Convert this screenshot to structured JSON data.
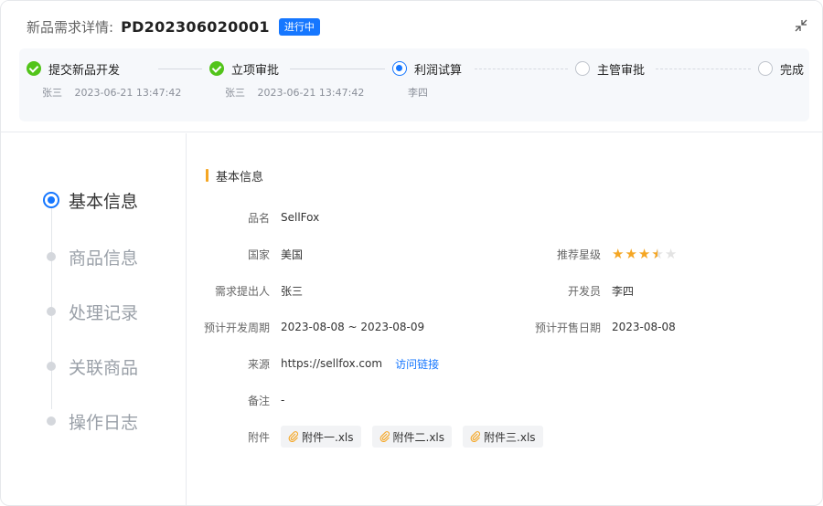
{
  "header": {
    "title_label": "新品需求详情:",
    "code": "PD202306020001",
    "status": "进行中"
  },
  "colors": {
    "primary": "#1677ff",
    "success": "#52c41a",
    "accent": "#f5a623"
  },
  "steps": [
    {
      "title": "提交新品开发",
      "person": "张三",
      "time": "2023-06-21 13:47:42",
      "state": "done"
    },
    {
      "title": "立项审批",
      "person": "张三",
      "time": "2023-06-21 13:47:42",
      "state": "done"
    },
    {
      "title": "利润试算",
      "person": "李四",
      "time": "",
      "state": "active"
    },
    {
      "title": "主管审批",
      "person": "",
      "time": "",
      "state": "wait"
    },
    {
      "title": "完成",
      "person": "",
      "time": "",
      "state": "wait"
    }
  ],
  "nav": {
    "items": [
      {
        "label": "基本信息",
        "active": true
      },
      {
        "label": "商品信息",
        "active": false
      },
      {
        "label": "处理记录",
        "active": false
      },
      {
        "label": "关联商品",
        "active": false
      },
      {
        "label": "操作日志",
        "active": false
      }
    ]
  },
  "section": {
    "title": "基本信息"
  },
  "fields": {
    "name": {
      "label": "品名",
      "value": "SellFox"
    },
    "country": {
      "label": "国家",
      "value": "美国"
    },
    "rating": {
      "label": "推荐星级",
      "value": 3.5,
      "max": 5
    },
    "requester": {
      "label": "需求提出人",
      "value": "张三"
    },
    "developer": {
      "label": "开发员",
      "value": "李四"
    },
    "dev_period": {
      "label": "预计开发周期",
      "value": "2023-08-08 ~ 2023-08-09"
    },
    "sale_date": {
      "label": "预计开售日期",
      "value": "2023-08-08"
    },
    "source": {
      "label": "来源",
      "value": "https://sellfox.com",
      "link": "访问链接"
    },
    "remark": {
      "label": "备注",
      "value": "-"
    },
    "attachments": {
      "label": "附件",
      "files": [
        "附件一.xls",
        "附件二.xls",
        "附件三.xls"
      ]
    }
  },
  "icons": {
    "collapse": "collapse-arrows-icon",
    "attachment": "paperclip-icon"
  }
}
